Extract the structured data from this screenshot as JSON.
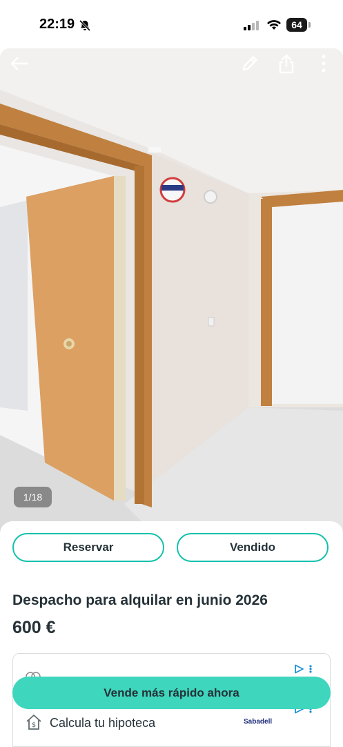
{
  "status": {
    "time": "22:19",
    "battery": "64"
  },
  "gallery": {
    "counter": "1/18"
  },
  "actions": {
    "reserve_label": "Reservar",
    "sold_label": "Vendido"
  },
  "listing": {
    "title": "Despacho para alquilar en junio 2026",
    "price": "600 €"
  },
  "ad": {
    "cta_label": "Vende más rápido ahora",
    "mortgage_label": "Calcula tu hipoteca",
    "bank": "Sabadell"
  },
  "colors": {
    "accent": "#13c1ac",
    "cta": "#3ed6bd",
    "text": "#253238"
  },
  "icons": [
    "bell-off-icon",
    "signal-icon",
    "wifi-icon",
    "battery-icon",
    "back-arrow-icon",
    "edit-pencil-icon",
    "share-icon",
    "more-vertical-icon",
    "ad-choices-icon",
    "calculator-house-icon"
  ]
}
